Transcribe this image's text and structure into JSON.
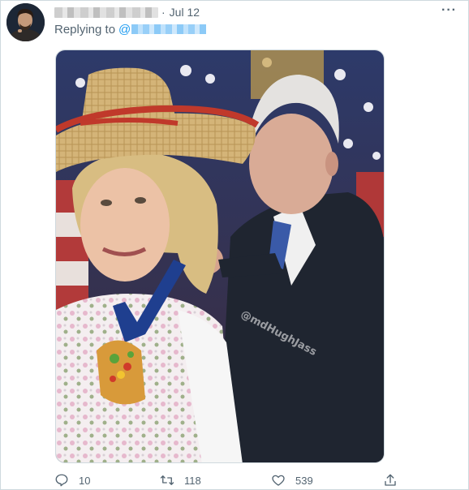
{
  "tweet": {
    "date": "Jul 12",
    "separator": "·",
    "more_label": "···",
    "replying_prefix": "Replying to",
    "reply_at": "@",
    "watermark": "@mdHughJass"
  },
  "actions": {
    "reply_count": "10",
    "retweet_count": "118",
    "like_count": "539"
  },
  "icons": {
    "reply": "reply-icon",
    "retweet": "retweet-icon",
    "like": "heart-icon",
    "share": "share-icon"
  },
  "colors": {
    "accent": "#1d9bf0",
    "muted_text": "#536471",
    "border": "#cfd9de"
  }
}
